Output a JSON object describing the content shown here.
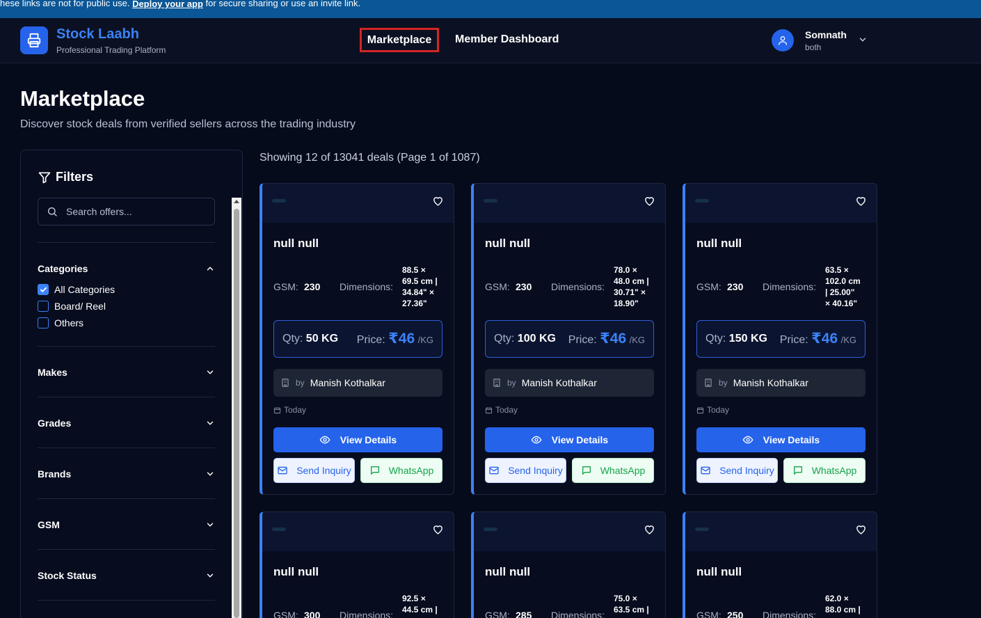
{
  "banner": {
    "prefix": "hese links are not for public use.",
    "link": "Deploy your app",
    "suffix": "for secure sharing or use an invite link."
  },
  "header": {
    "brand": "Stock Laabh",
    "tagline": "Professional Trading Platform",
    "nav": [
      {
        "label": "Marketplace",
        "active": true
      },
      {
        "label": "Member Dashboard",
        "active": false
      }
    ],
    "user": {
      "name": "Somnath",
      "role": "both"
    }
  },
  "page": {
    "title": "Marketplace",
    "subtitle": "Discover stock deals from verified sellers across the trading industry",
    "showing": "Showing 12 of 13041 deals (Page 1 of 1087)"
  },
  "filters": {
    "title": "Filters",
    "search_placeholder": "Search offers...",
    "categories_label": "Categories",
    "categories": [
      {
        "label": "All Categories",
        "checked": true
      },
      {
        "label": "Board/ Reel",
        "checked": false
      },
      {
        "label": "Others",
        "checked": false
      }
    ],
    "sections": [
      "Makes",
      "Grades",
      "Brands",
      "GSM",
      "Stock Status"
    ]
  },
  "labels": {
    "gsm": "GSM:",
    "dimensions": "Dimensions:",
    "qty": "Qty:",
    "price": "Price:",
    "per": "/KG",
    "by": "by",
    "view": "View Details",
    "inquiry": "Send Inquiry",
    "whatsapp": "WhatsApp"
  },
  "deals": [
    {
      "title": "null null",
      "gsm": "230",
      "dim": [
        "88.5 ×",
        "69.5 cm |",
        "34.84\" ×",
        "27.36\""
      ],
      "qty": "50 KG",
      "price": "₹46",
      "seller": "Manish Kothalkar",
      "date": "Today"
    },
    {
      "title": "null null",
      "gsm": "230",
      "dim": [
        "78.0 ×",
        "48.0 cm |",
        "30.71\" ×",
        "18.90\""
      ],
      "qty": "100 KG",
      "price": "₹46",
      "seller": "Manish Kothalkar",
      "date": "Today"
    },
    {
      "title": "null null",
      "gsm": "230",
      "dim": [
        "63.5 ×",
        "102.0 cm",
        "| 25.00\"",
        "× 40.16\""
      ],
      "qty": "150 KG",
      "price": "₹46",
      "seller": "Manish Kothalkar",
      "date": "Today"
    },
    {
      "title": "null null",
      "gsm": "300",
      "dim": [
        "92.5 ×",
        "44.5 cm |"
      ],
      "qty": "",
      "price": "",
      "seller": "",
      "date": ""
    },
    {
      "title": "null null",
      "gsm": "285",
      "dim": [
        "75.0 ×",
        "63.5 cm |"
      ],
      "qty": "",
      "price": "",
      "seller": "",
      "date": ""
    },
    {
      "title": "null null",
      "gsm": "250",
      "dim": [
        "62.0 ×",
        "88.0 cm |"
      ],
      "qty": "",
      "price": "",
      "seller": "",
      "date": ""
    }
  ],
  "colors": {
    "accent": "#3b82f6",
    "primary_button": "#2563eb",
    "whatsapp": "#16a34a",
    "active_outline": "#d62424"
  }
}
